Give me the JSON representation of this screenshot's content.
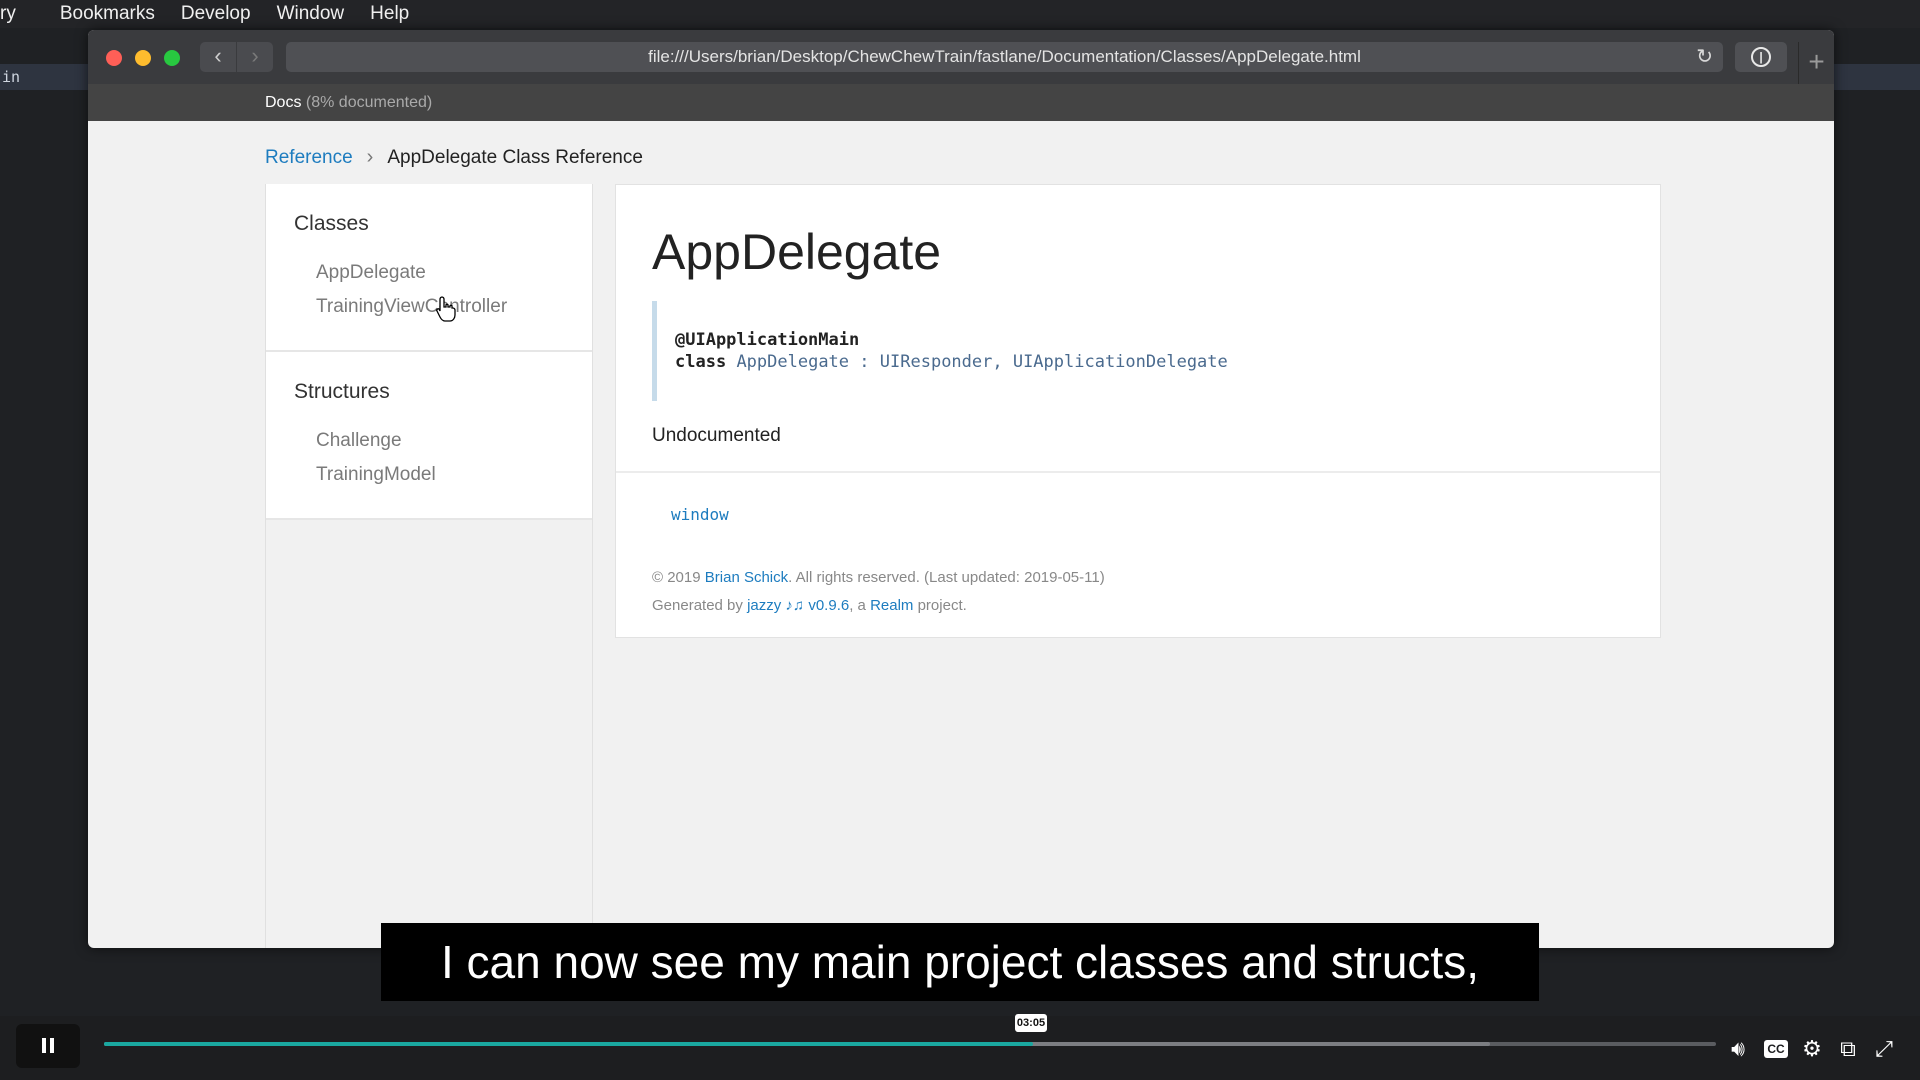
{
  "menubar": {
    "items": [
      "ry",
      "Bookmarks",
      "Develop",
      "Window",
      "Help"
    ]
  },
  "background": {
    "editor_fragment": "in"
  },
  "browser": {
    "url": "file:///Users/brian/Desktop/ChewChewTrain/fastlane/Documentation/Classes/AppDelegate.html"
  },
  "docs_header": {
    "title": "Docs",
    "coverage": "(8% documented)"
  },
  "breadcrumb": {
    "root": "Reference",
    "current": "AppDelegate Class Reference"
  },
  "sidebar": {
    "sections": [
      {
        "title": "Classes",
        "items": [
          "AppDelegate",
          "TrainingViewController"
        ]
      },
      {
        "title": "Structures",
        "items": [
          "Challenge",
          "TrainingModel"
        ]
      }
    ]
  },
  "main": {
    "title": "AppDelegate",
    "declaration": {
      "attribute": "@UIApplicationMain",
      "keyword": "class",
      "name": "AppDelegate",
      "separator": ":",
      "conformances": "UIResponder, UIApplicationDelegate"
    },
    "abstract": "Undocumented",
    "properties": [
      "window"
    ],
    "footer": {
      "copyright_prefix": "© 2019",
      "author": "Brian Schick",
      "copyright_suffix": ". All rights reserved. (Last updated: 2019-05-11)",
      "generated_prefix": "Generated by",
      "generator": "jazzy ♪♫ v0.9.6",
      "generated_middle": ", a",
      "org": "Realm",
      "generated_suffix": "project."
    }
  },
  "video": {
    "caption": "I can now see my main project classes and structs,",
    "time_tooltip": "03:05",
    "progress_fraction": 0.576,
    "buffered_fraction": 0.86,
    "accent_color": "#1aa8a0"
  }
}
